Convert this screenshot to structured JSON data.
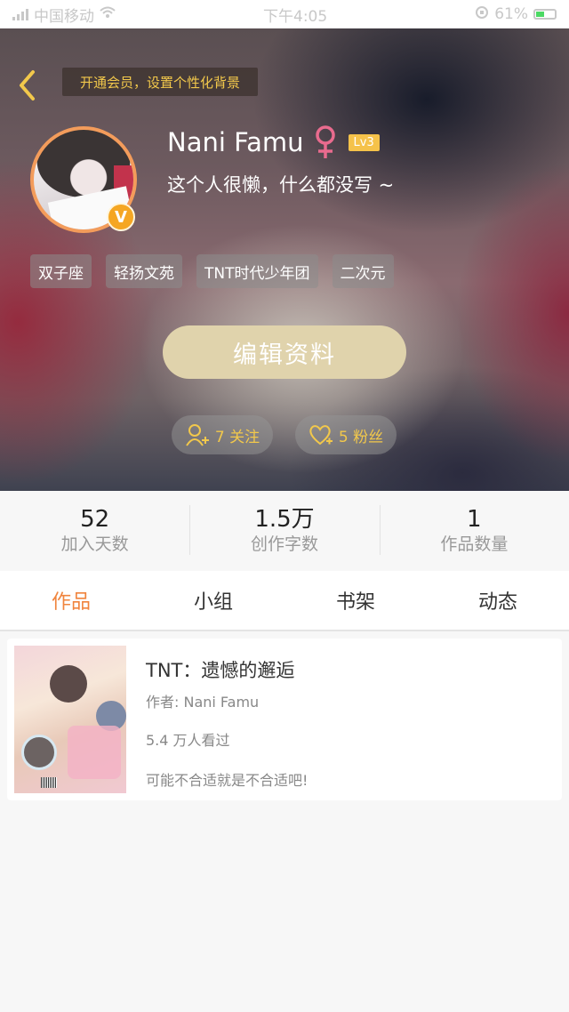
{
  "statusbar": {
    "carrier": "中国移动",
    "time": "下午4:05",
    "battery": "61%"
  },
  "header": {
    "vip_banner": "开通会员，设置个性化背景"
  },
  "profile": {
    "name": "Nani Famu",
    "level": "Lv3",
    "bio": "这个人很懒，什么都没写 ~",
    "badge": "V"
  },
  "tags": [
    "双子座",
    "轻扬文苑",
    "TNT时代少年团",
    "二次元"
  ],
  "edit_button": "编辑资料",
  "follow": {
    "label": "7 关注"
  },
  "fans": {
    "label": "5 粉丝"
  },
  "stats": [
    {
      "value": "52",
      "label": "加入天数"
    },
    {
      "value": "1.5万",
      "label": "创作字数"
    },
    {
      "value": "1",
      "label": "作品数量"
    }
  ],
  "tabs": [
    "作品",
    "小组",
    "书架",
    "动态"
  ],
  "active_tab": "作品",
  "works": [
    {
      "title": "TNT：遗憾的邂逅",
      "author": "作者: Nani Famu",
      "views": "5.4 万人看过",
      "description": "可能不合适就是不合适吧!"
    }
  ],
  "colors": {
    "accent": "#f0843d",
    "gold": "#f2c84b",
    "edit_button": "#e0d3ac",
    "gender": "#e96b8e"
  }
}
